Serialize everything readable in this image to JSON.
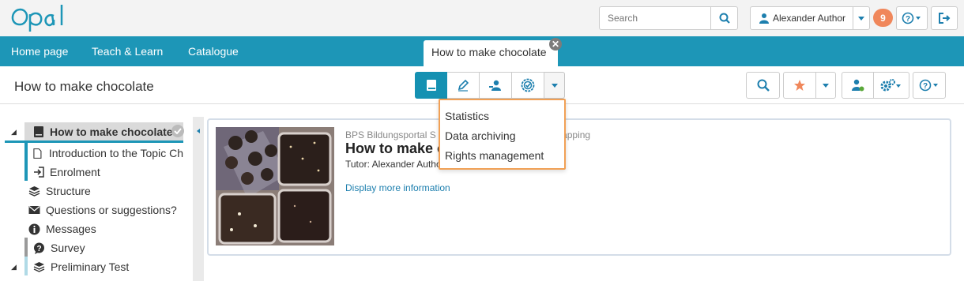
{
  "header": {
    "logo": "Opal",
    "search_placeholder": "Search",
    "user_name": "Alexander Author",
    "notification_count": "9"
  },
  "nav": {
    "items": [
      {
        "label": "Home page"
      },
      {
        "label": "Teach & Learn"
      },
      {
        "label": "Catalogue"
      }
    ],
    "active_tab": "How to make chocolate"
  },
  "title": "How to make chocolate",
  "dropdown": {
    "items": [
      "Statistics",
      "Data archiving",
      "Rights management"
    ]
  },
  "tree": {
    "items": [
      {
        "label": "How to make chocolate"
      },
      {
        "label": "Introduction to the Topic Ch"
      },
      {
        "label": "Enrolment"
      },
      {
        "label": "Structure"
      },
      {
        "label": "Questions or suggestions?"
      },
      {
        "label": "Messages"
      },
      {
        "label": "Survey"
      },
      {
        "label": "Preliminary Test"
      }
    ]
  },
  "card": {
    "provider": "BPS Bildungsportal S",
    "provider_tail": "erlapping",
    "title": "How to make c",
    "tutor": "Tutor: Alexander Autho",
    "more_link": "Display more information"
  },
  "colors": {
    "nav": "#1d96b7",
    "accent_border": "#f1a055",
    "badge": "#f0875b"
  }
}
